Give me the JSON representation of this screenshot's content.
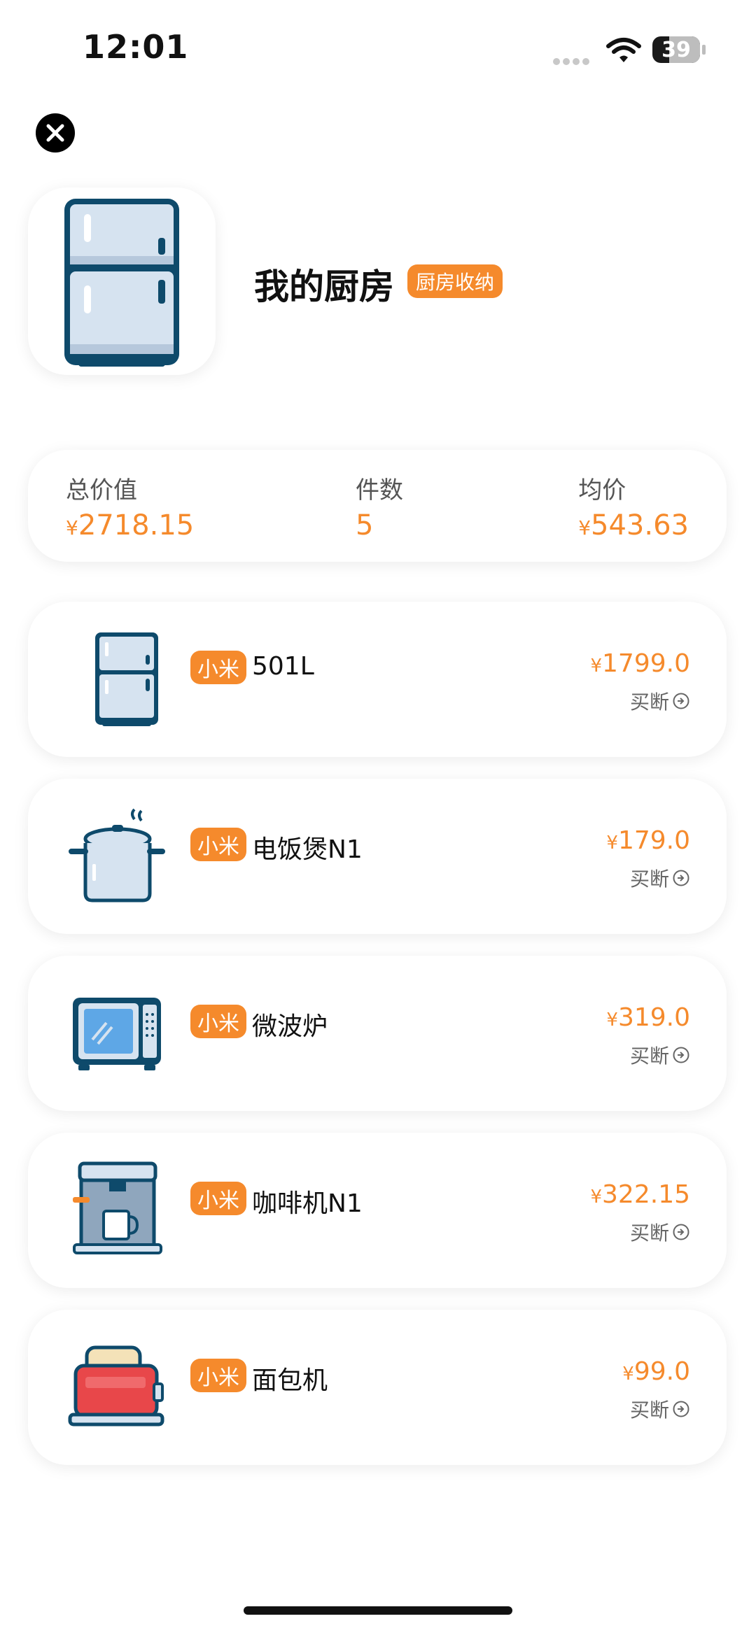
{
  "status_bar": {
    "time": "12:01",
    "battery": "39"
  },
  "header": {
    "title": "我的厨房",
    "tag": "厨房收纳"
  },
  "summary": {
    "total_label": "总价值",
    "total_currency": "¥",
    "total_value": "2718.15",
    "count_label": "件数",
    "count_value": "5",
    "avg_label": "均价",
    "avg_currency": "¥",
    "avg_value": "543.63"
  },
  "items": [
    {
      "icon": "fridge-icon",
      "brand": "小米",
      "name": "501L",
      "currency": "¥",
      "price": "1799.0",
      "pay_type": "买断"
    },
    {
      "icon": "rice-cooker-icon",
      "brand": "小米",
      "name": "电饭煲N1",
      "currency": "¥",
      "price": "179.0",
      "pay_type": "买断"
    },
    {
      "icon": "microwave-icon",
      "brand": "小米",
      "name": "微波炉",
      "currency": "¥",
      "price": "319.0",
      "pay_type": "买断"
    },
    {
      "icon": "coffee-machine-icon",
      "brand": "小米",
      "name": "咖啡机N1",
      "currency": "¥",
      "price": "322.15",
      "pay_type": "买断"
    },
    {
      "icon": "toaster-icon",
      "brand": "小米",
      "name": "面包机",
      "currency": "¥",
      "price": "99.0",
      "pay_type": "买断"
    }
  ],
  "colors": {
    "accent": "#f58a2c",
    "icon_stroke": "#0e4a6b",
    "icon_fill": "#d6e3f0"
  }
}
